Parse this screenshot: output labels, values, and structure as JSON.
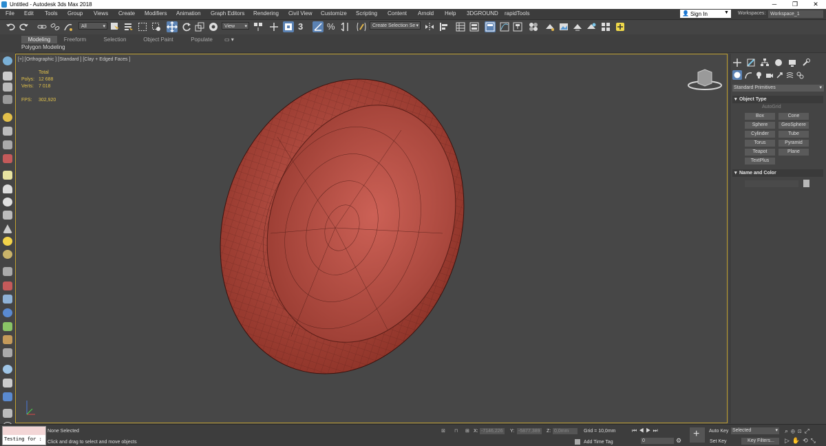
{
  "window": {
    "title": "Untitled - Autodesk 3ds Max 2018",
    "min": "─",
    "max": "❐",
    "close": "✕"
  },
  "menu": [
    "File",
    "Edit",
    "Tools",
    "Group",
    "Views",
    "Create",
    "Modifiers",
    "Animation",
    "Graph Editors",
    "Rendering",
    "Civil View",
    "Customize",
    "Scripting",
    "Content",
    "Arnold",
    "Help",
    "3DGROUND",
    "rapidTools"
  ],
  "account": {
    "signin": "Sign In",
    "workspaces_label": "Workspaces:",
    "workspace": "Workspace_1"
  },
  "toolbar": {
    "filter": "All",
    "ref_coord": "View",
    "selection_set": "Create Selection Se",
    "snap_label": "3"
  },
  "ribbon": {
    "tabs": [
      "Modeling",
      "Freeform",
      "Selection",
      "Object Paint",
      "Populate"
    ],
    "panel_label": "Polygon Modeling"
  },
  "viewport": {
    "label": "[+] [Orthographic ] [Standard ] [Clay + Edged Faces ]",
    "stats": {
      "header": "Total",
      "polys_label": "Polys:",
      "polys": "12 688",
      "verts_label": "Verts:",
      "verts": "7 018",
      "fps_label": "FPS:",
      "fps": "302,920"
    }
  },
  "command_panel": {
    "category": "Standard Primitives",
    "object_type_header": "Object Type",
    "autogrid": "AutoGrid",
    "primitives": [
      "Box",
      "Cone",
      "Sphere",
      "GeoSphere",
      "Cylinder",
      "Tube",
      "Torus",
      "Pyramid",
      "Teapot",
      "Plane",
      "TextPlus"
    ],
    "name_color_header": "Name and Color"
  },
  "status": {
    "maxscript": "Testing for :",
    "selection": "None Selected",
    "prompt": "Click and drag to select and move objects",
    "x_label": "X:",
    "x": "-7146,226",
    "y_label": "Y:",
    "y": "-5877,389",
    "z_label": "Z:",
    "z": "0,0mm",
    "grid": "Grid = 10,0mm",
    "add_time_tag": "Add Time Tag",
    "frame": "0",
    "auto_key": "Auto Key",
    "set_key": "Set Key",
    "selected": "Selected",
    "key_filters": "Key Filters..."
  },
  "colors": {
    "accent": "#5b82b3",
    "viewport_border": "#c0a030",
    "stats": "#e2c24a",
    "model": "#b24a40"
  }
}
